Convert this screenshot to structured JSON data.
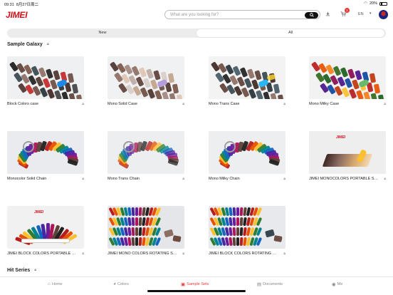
{
  "status_bar": {
    "time": "09:31",
    "date": "8月27日周二",
    "battery": "20%"
  },
  "header": {
    "logo": "JIMEI",
    "search_placeholder": "What are you looking for?",
    "cart_count": "1",
    "language": "EN"
  },
  "tabs": [
    {
      "label": "New",
      "active": false
    },
    {
      "label": "All",
      "active": true
    }
  ],
  "sections": {
    "sample_galaxy": "Sample Galaxy",
    "hit_series": "Hit Series"
  },
  "cards": [
    {
      "label": "Block Colors case",
      "art": "fan-dark"
    },
    {
      "label": "Mono Solid Case",
      "art": "fan-pastel"
    },
    {
      "label": "Mono Trans Case",
      "art": "fan-trans"
    },
    {
      "label": "Mono Milky Case",
      "art": "fan-milky"
    },
    {
      "label": "Monocolor Solid Chain",
      "art": "chain-solid"
    },
    {
      "label": "Mono Trans Chain",
      "art": "chain-trans"
    },
    {
      "label": "Mono Milky Chain",
      "art": "chain-milky"
    },
    {
      "label": "JIMEI MONOCOLORS PORTABLE SA...",
      "art": "portable-mono"
    },
    {
      "label": "JIMEI BLOCK COLORS PORTABLE S...",
      "art": "portable-block"
    },
    {
      "label": "JIMEI MONO COLORS ROTATING ST...",
      "art": "rotating-mono"
    },
    {
      "label": "JIMEI BLOCK COLORS ROTATING ST...",
      "art": "rotating-block"
    }
  ],
  "bottom_nav": [
    {
      "label": "Home",
      "icon": "home-icon",
      "active": false
    },
    {
      "label": "Colors",
      "icon": "palette-icon",
      "active": false
    },
    {
      "label": "Sample Sets",
      "icon": "sample-sets-icon",
      "active": true
    },
    {
      "label": "Documents",
      "icon": "document-icon",
      "active": false
    },
    {
      "label": "Me",
      "icon": "user-icon",
      "active": false
    }
  ],
  "colors": {
    "brand_red": "#d0101a",
    "active_nav": "#e53935"
  }
}
